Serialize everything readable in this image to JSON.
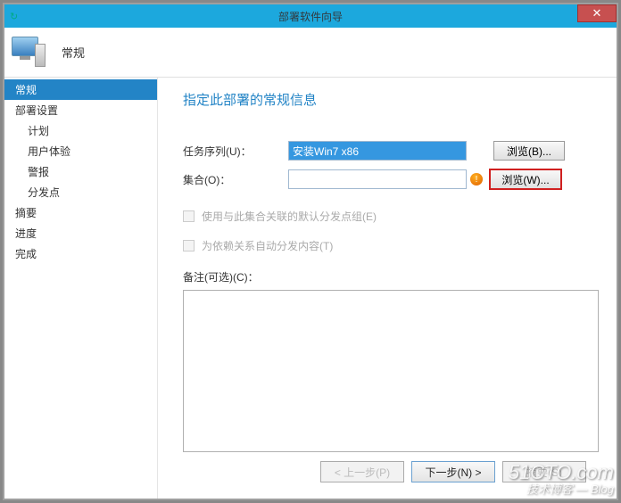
{
  "window": {
    "title": "部署软件向导",
    "close": "✕",
    "refresh": "↻"
  },
  "header": {
    "title": "常规"
  },
  "sidebar": {
    "items": [
      {
        "label": "常规",
        "active": true,
        "child": false
      },
      {
        "label": "部署设置",
        "active": false,
        "child": false
      },
      {
        "label": "计划",
        "active": false,
        "child": true
      },
      {
        "label": "用户体验",
        "active": false,
        "child": true
      },
      {
        "label": "警报",
        "active": false,
        "child": true
      },
      {
        "label": "分发点",
        "active": false,
        "child": true
      },
      {
        "label": "摘要",
        "active": false,
        "child": false
      },
      {
        "label": "进度",
        "active": false,
        "child": false
      },
      {
        "label": "完成",
        "active": false,
        "child": false
      }
    ]
  },
  "main": {
    "title": "指定此部署的常规信息",
    "task_label": "任务序列(U)：",
    "task_value": "安装Win7 x86",
    "collection_label": "集合(O)：",
    "collection_value": "",
    "browse_b": "浏览(B)...",
    "browse_w": "浏览(W)...",
    "warn": "!",
    "chk1": "使用与此集合关联的默认分发点组(E)",
    "chk2": "为依赖关系自动分发内容(T)",
    "notes_label": "备注(可选)(C)："
  },
  "buttons": {
    "prev": "< 上一步(P)",
    "next": "下一步(N) >",
    "summary": "摘要(S)"
  },
  "watermark": {
    "main": "51CTO.com",
    "sub": "技术博客 — Blog"
  }
}
